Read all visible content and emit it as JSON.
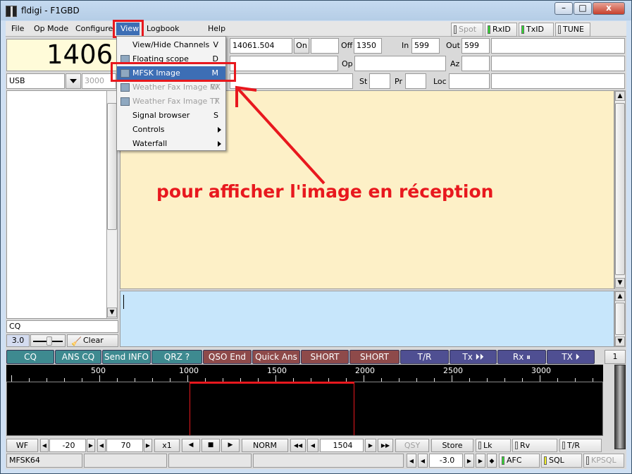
{
  "window": {
    "title": "fldigi - F1GBD",
    "min_label": "–",
    "max_label": "□",
    "close_label": "x"
  },
  "menubar": {
    "file": "File",
    "opmode": "Op Mode",
    "configure": "Configure",
    "view": "View",
    "logbook": "Logbook",
    "help": "Help"
  },
  "indicators": {
    "spot": "Spot",
    "rxid": "RxID",
    "txid": "TxID",
    "tune": "TUNE"
  },
  "frequency": {
    "display": "14061.504",
    "partial_display": "1406"
  },
  "fields": {
    "freq_value": "14061.504",
    "on_label": "On",
    "off_label": "Off",
    "off_value": "1350",
    "in_label": "In",
    "in_value": "599",
    "out_label": "Out",
    "out_value": "599",
    "op_label": "Op",
    "az_label": "Az",
    "st_label": "St",
    "pr_label": "Pr",
    "loc_label": "Loc"
  },
  "mode_select": {
    "value": "USB",
    "bandwidth": "3000"
  },
  "sidebar": {
    "cq_text": "CQ",
    "squelch_value": "3.0",
    "clear_label": "Clear"
  },
  "view_menu": {
    "items": [
      {
        "label": "View/Hide Channels",
        "shortcut": "V",
        "state": "normal",
        "icon": "",
        "submenu": false
      },
      {
        "label": "Floating scope",
        "shortcut": "D",
        "state": "normal",
        "icon": "scope-icon",
        "submenu": false
      },
      {
        "label": "MFSK Image",
        "shortcut": "M",
        "state": "selected",
        "icon": "image-icon",
        "submenu": false
      },
      {
        "label": "Weather Fax Image RX",
        "shortcut": "W",
        "state": "disabled",
        "icon": "image-icon",
        "submenu": false
      },
      {
        "label": "Weather Fax Image TX",
        "shortcut": "T",
        "state": "disabled",
        "icon": "image-icon",
        "submenu": false
      },
      {
        "label": "Signal browser",
        "shortcut": "S",
        "state": "normal",
        "icon": "",
        "submenu": false
      },
      {
        "label": "Controls",
        "shortcut": "",
        "state": "normal",
        "icon": "",
        "submenu": true
      },
      {
        "label": "Waterfall",
        "shortcut": "",
        "state": "normal",
        "icon": "",
        "submenu": true
      }
    ]
  },
  "annotation": {
    "text": "pour afficher l'image en réception",
    "color": "#e8181e"
  },
  "macros": [
    {
      "label": "CQ",
      "color": "teal"
    },
    {
      "label": "ANS CQ",
      "color": "teal"
    },
    {
      "label": "Send INFO",
      "color": "teal"
    },
    {
      "label": "QRZ ?",
      "color": "teal"
    },
    {
      "label": "QSO End",
      "color": "brown"
    },
    {
      "label": "Quick Ans",
      "color": "brown"
    },
    {
      "label": "SHORT ANS",
      "color": "brown"
    },
    {
      "label": "SHORT END",
      "color": "brown"
    },
    {
      "label": "T/R",
      "color": "navy"
    },
    {
      "label": "Tx ⏵⏵",
      "color": "navy"
    },
    {
      "label": "Rx ⏸",
      "color": "navy"
    },
    {
      "label": "TX ⏵",
      "color": "navy"
    }
  ],
  "macro_page": "1",
  "waterfall": {
    "scale_labels": [
      "500",
      "1000",
      "1500",
      "2000",
      "2500",
      "3000"
    ],
    "marker_color": "#e8181e"
  },
  "wf_controls": {
    "wf_label": "WF",
    "ref_value": "-20",
    "range_value": "70",
    "zoom_label": "x1",
    "mode_label": "NORM",
    "carrier_value": "1504",
    "qsy_label": "QSY",
    "store_label": "Store",
    "lk_label": "Lk",
    "rv_label": "Rv",
    "tr_label": "T/R"
  },
  "status": {
    "mode": "MFSK64",
    "afc_value": "-3.0",
    "afc_label": "AFC",
    "sql_label": "SQL",
    "kpsql_label": "KPSQL"
  }
}
